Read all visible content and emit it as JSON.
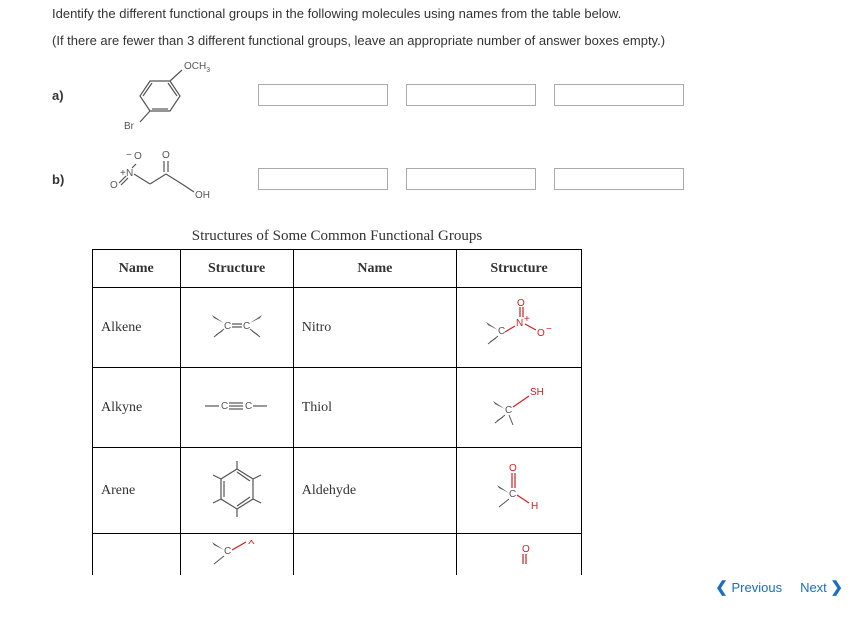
{
  "instruction1": "Identify the different functional groups in the following molecules using names from the table below.",
  "instruction2": "(If there are fewer than 3 different functional groups, leave an appropriate number of answer boxes empty.)",
  "questions": {
    "a": {
      "label": "a)",
      "mol": {
        "top_label": "OCH",
        "top_sub": "3",
        "bl_label": "Br"
      }
    },
    "b": {
      "label": "b)",
      "mol": {
        "oh": "OH",
        "o": "O"
      }
    }
  },
  "table": {
    "title": "Structures of Some Common Functional Groups",
    "headers": {
      "name": "Name",
      "structure": "Structure"
    },
    "rows": [
      {
        "name1": "Alkene",
        "s1": "alkene",
        "name2": "Nitro",
        "s2": "nitro"
      },
      {
        "name1": "Alkyne",
        "s1": "alkyne",
        "name2": "Thiol",
        "s2": "thiol"
      },
      {
        "name1": "Arene",
        "s1": "arene",
        "name2": "Aldehyde",
        "s2": "aldehyde"
      }
    ],
    "partial": {
      "s1": "halide",
      "s2": "partial"
    }
  },
  "nav": {
    "prev": "Previous",
    "next": "Next"
  }
}
